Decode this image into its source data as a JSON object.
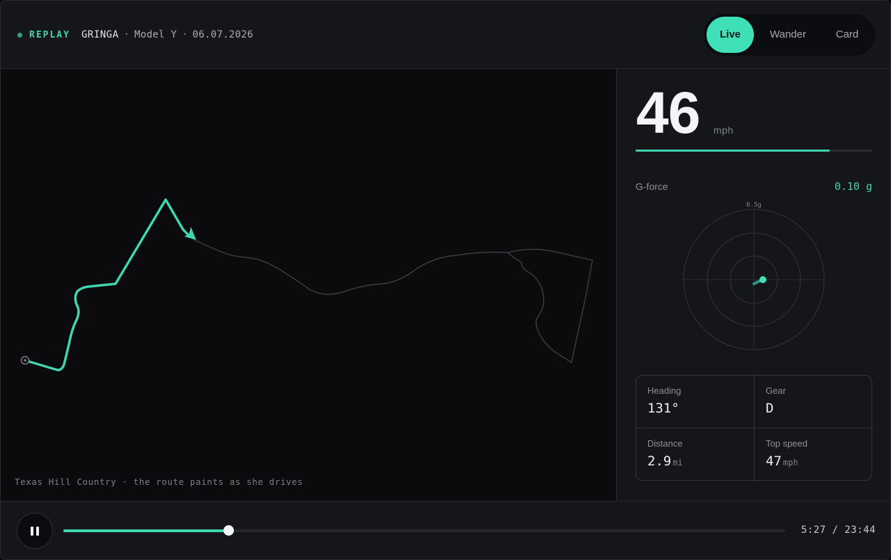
{
  "header": {
    "status": "REPLAY",
    "driver": "GRINGA",
    "separator": "·",
    "vehicle": "Model Y",
    "date": "06.07.2026",
    "modes": [
      {
        "label": "Live",
        "active": true
      },
      {
        "label": "Wander",
        "active": false
      },
      {
        "label": "Card",
        "active": false
      }
    ]
  },
  "map": {
    "caption": "Texas Hill Country · the route paints as she drives",
    "route_color": "#3fd6b0",
    "route_remaining_color": "#3a3c40",
    "start_marker_icon": "start-ring-icon",
    "position_marker_icon": "heading-arrow-icon"
  },
  "telemetry": {
    "speed": "46",
    "speed_unit": "mph",
    "speed_fraction": 0.82,
    "g_force_label": "G-force",
    "g_force_value": "0.10 g",
    "g_ring_label": "0.5g"
  },
  "stats": {
    "heading_label": "Heading",
    "heading_value": "131°",
    "gear_label": "Gear",
    "gear_value": "D",
    "distance_label": "Distance",
    "distance_value": "2.9",
    "distance_unit": "mi",
    "top_speed_label": "Top speed",
    "top_speed_value": "47",
    "top_speed_unit": "mph"
  },
  "playback": {
    "play_state_icon": "pause-icon",
    "progress_fraction": 0.229,
    "time": "5:27 / 23:44"
  },
  "colors": {
    "accent": "#3fd6b0",
    "background": "#141518",
    "map_background": "#0b0b0d"
  }
}
